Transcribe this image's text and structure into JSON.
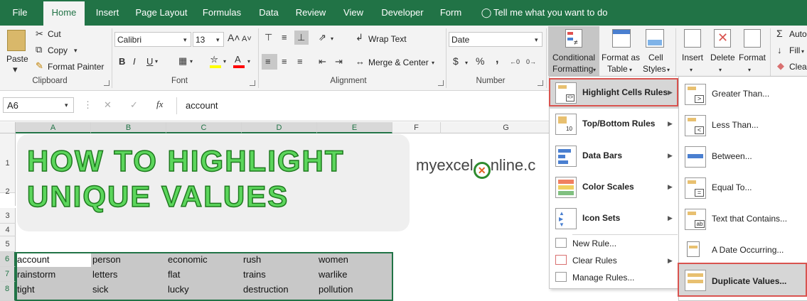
{
  "tabs": [
    "File",
    "Home",
    "Insert",
    "Page Layout",
    "Formulas",
    "Data",
    "Review",
    "View",
    "Developer",
    "Form"
  ],
  "tell_me": "Tell me what you want to do",
  "clipboard": {
    "paste": "Paste",
    "cut": "Cut",
    "copy": "Copy",
    "format_painter": "Format Painter",
    "label": "Clipboard"
  },
  "font": {
    "name": "Calibri",
    "size": "13",
    "label": "Font"
  },
  "alignment": {
    "wrap": "Wrap Text",
    "merge": "Merge & Center",
    "label": "Alignment"
  },
  "number": {
    "format": "Date",
    "currency": "$",
    "percent": "%",
    "comma": ",",
    "label": "Number"
  },
  "styles": {
    "cf_line1": "Conditional",
    "cf_line2": "Formatting",
    "fat_line1": "Format as",
    "fat_line2": "Table",
    "cs_line1": "Cell",
    "cs_line2": "Styles"
  },
  "cells": {
    "insert": "Insert",
    "delete": "Delete",
    "format": "Format"
  },
  "editing": {
    "autosum": "Auto",
    "fill": "Fill",
    "clear": "Clea"
  },
  "name_box": "A6",
  "formula_icon": "fx",
  "formula_value": "account",
  "columns": [
    "A",
    "B",
    "C",
    "D",
    "E",
    "F",
    "G"
  ],
  "rows": [
    "1",
    "2",
    "3",
    "4",
    "5",
    "6",
    "7",
    "8"
  ],
  "banner": {
    "line1": "HOW TO HIGHLIGHT",
    "line2": "UNIQUE VALUES"
  },
  "logo": {
    "part1": "myexcel",
    "part2": "nline.c"
  },
  "data_rows": [
    [
      "account",
      "person",
      "economic",
      "rush",
      "women"
    ],
    [
      "rainstorm",
      "letters",
      "flat",
      "trains",
      "warlike"
    ],
    [
      "tight",
      "sick",
      "lucky",
      "destruction",
      "pollution"
    ]
  ],
  "cf_menu": [
    "Highlight Cells Rules",
    "Top/Bottom Rules",
    "Data Bars",
    "Color Scales",
    "Icon Sets",
    "New Rule...",
    "Clear Rules",
    "Manage Rules..."
  ],
  "hc_menu": [
    "Greater Than...",
    "Less Than...",
    "Between...",
    "Equal To...",
    "Text that Contains...",
    "A Date Occurring...",
    "Duplicate Values..."
  ],
  "colors": {
    "excel_green": "#217346",
    "highlight_red": "#d9534f",
    "title_green": "#5cd65c"
  }
}
